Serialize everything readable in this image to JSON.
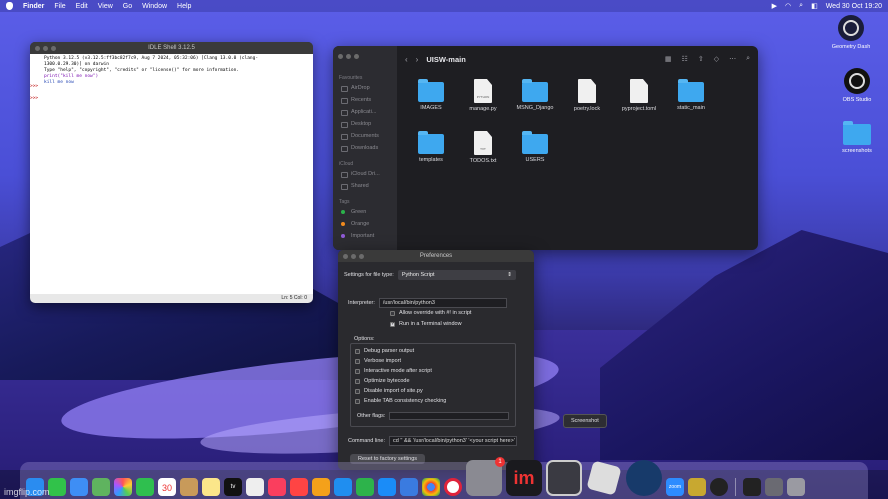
{
  "menubar": {
    "app_name": "Finder",
    "items": [
      "File",
      "Edit",
      "View",
      "Go",
      "Window",
      "Help"
    ],
    "clock": "Wed 30 Oct 19:20"
  },
  "idle": {
    "title": "IDLE Shell 3.12.5",
    "lines": [
      "Python 3.12.5 (v3.12.5:ff3bc82f7c9, Aug  7 2024, 05:32:06) [Clang 13.0.0 (clang-",
      "1300.0.29.30)] on darwin",
      "Type \"help\", \"copyright\", \"credits\" or \"license()\" for more information.",
      "print(\"kill me now\")",
      "kill me now"
    ],
    "prompts": [
      ">>>",
      ">>>"
    ],
    "status": "Ln: 5  Col: 0"
  },
  "finder": {
    "path_title": "UISW-main",
    "sidebar": {
      "favourites_label": "Favourites",
      "favourites": [
        "AirDrop",
        "Recents",
        "Applicati...",
        "Desktop",
        "Documents",
        "Downloads"
      ],
      "icloud_label": "iCloud",
      "icloud": [
        "iCloud Dri...",
        "Shared"
      ],
      "tags_label": "Tags",
      "tags": [
        "Green",
        "Orange",
        "Important"
      ]
    },
    "files": [
      {
        "name": "IMAGES",
        "kind": "folder"
      },
      {
        "name": "manage.py",
        "kind": "doc",
        "ext": "PYTHON"
      },
      {
        "name": "MSNG_Django",
        "kind": "folder"
      },
      {
        "name": "poetry.lock",
        "kind": "doc",
        "ext": ""
      },
      {
        "name": "pyproject.toml",
        "kind": "doc",
        "ext": ""
      },
      {
        "name": "static_main",
        "kind": "folder"
      },
      {
        "name": "templates",
        "kind": "folder"
      },
      {
        "name": "TODOS.txt",
        "kind": "doc",
        "ext": "TXT"
      },
      {
        "name": "USERS",
        "kind": "folder"
      }
    ]
  },
  "prefs": {
    "title": "Preferences",
    "file_type_label": "Settings for file type:",
    "file_type_value": "Python Script",
    "interpreter_label": "Interpreter:",
    "interpreter_value": "/usr/local/bin/python3",
    "allow_override": "Allow override with #! in script",
    "run_terminal": "Run in a Terminal window",
    "options_label": "Options:",
    "options": [
      "Debug parser output",
      "Verbose import",
      "Interactive mode after script",
      "Optimize bytecode",
      "Disable import of site.py",
      "Enable TAB consistency checking"
    ],
    "other_flags_label": "Other flags:",
    "command_line_label": "Command line:",
    "command_line_value": "cd '' && '/usr/local/bin/python3'  '<your script here>'",
    "reset_button": "Reset to factory settings"
  },
  "desktop": {
    "icons": [
      "Geometry Dash",
      "OBS Studio",
      "screenshots"
    ]
  },
  "tooltip": "Screenshot",
  "dock": {
    "badge": "1",
    "calendar_day": "30",
    "zoom_label": "zoom"
  },
  "watermark": "imgflip.com"
}
